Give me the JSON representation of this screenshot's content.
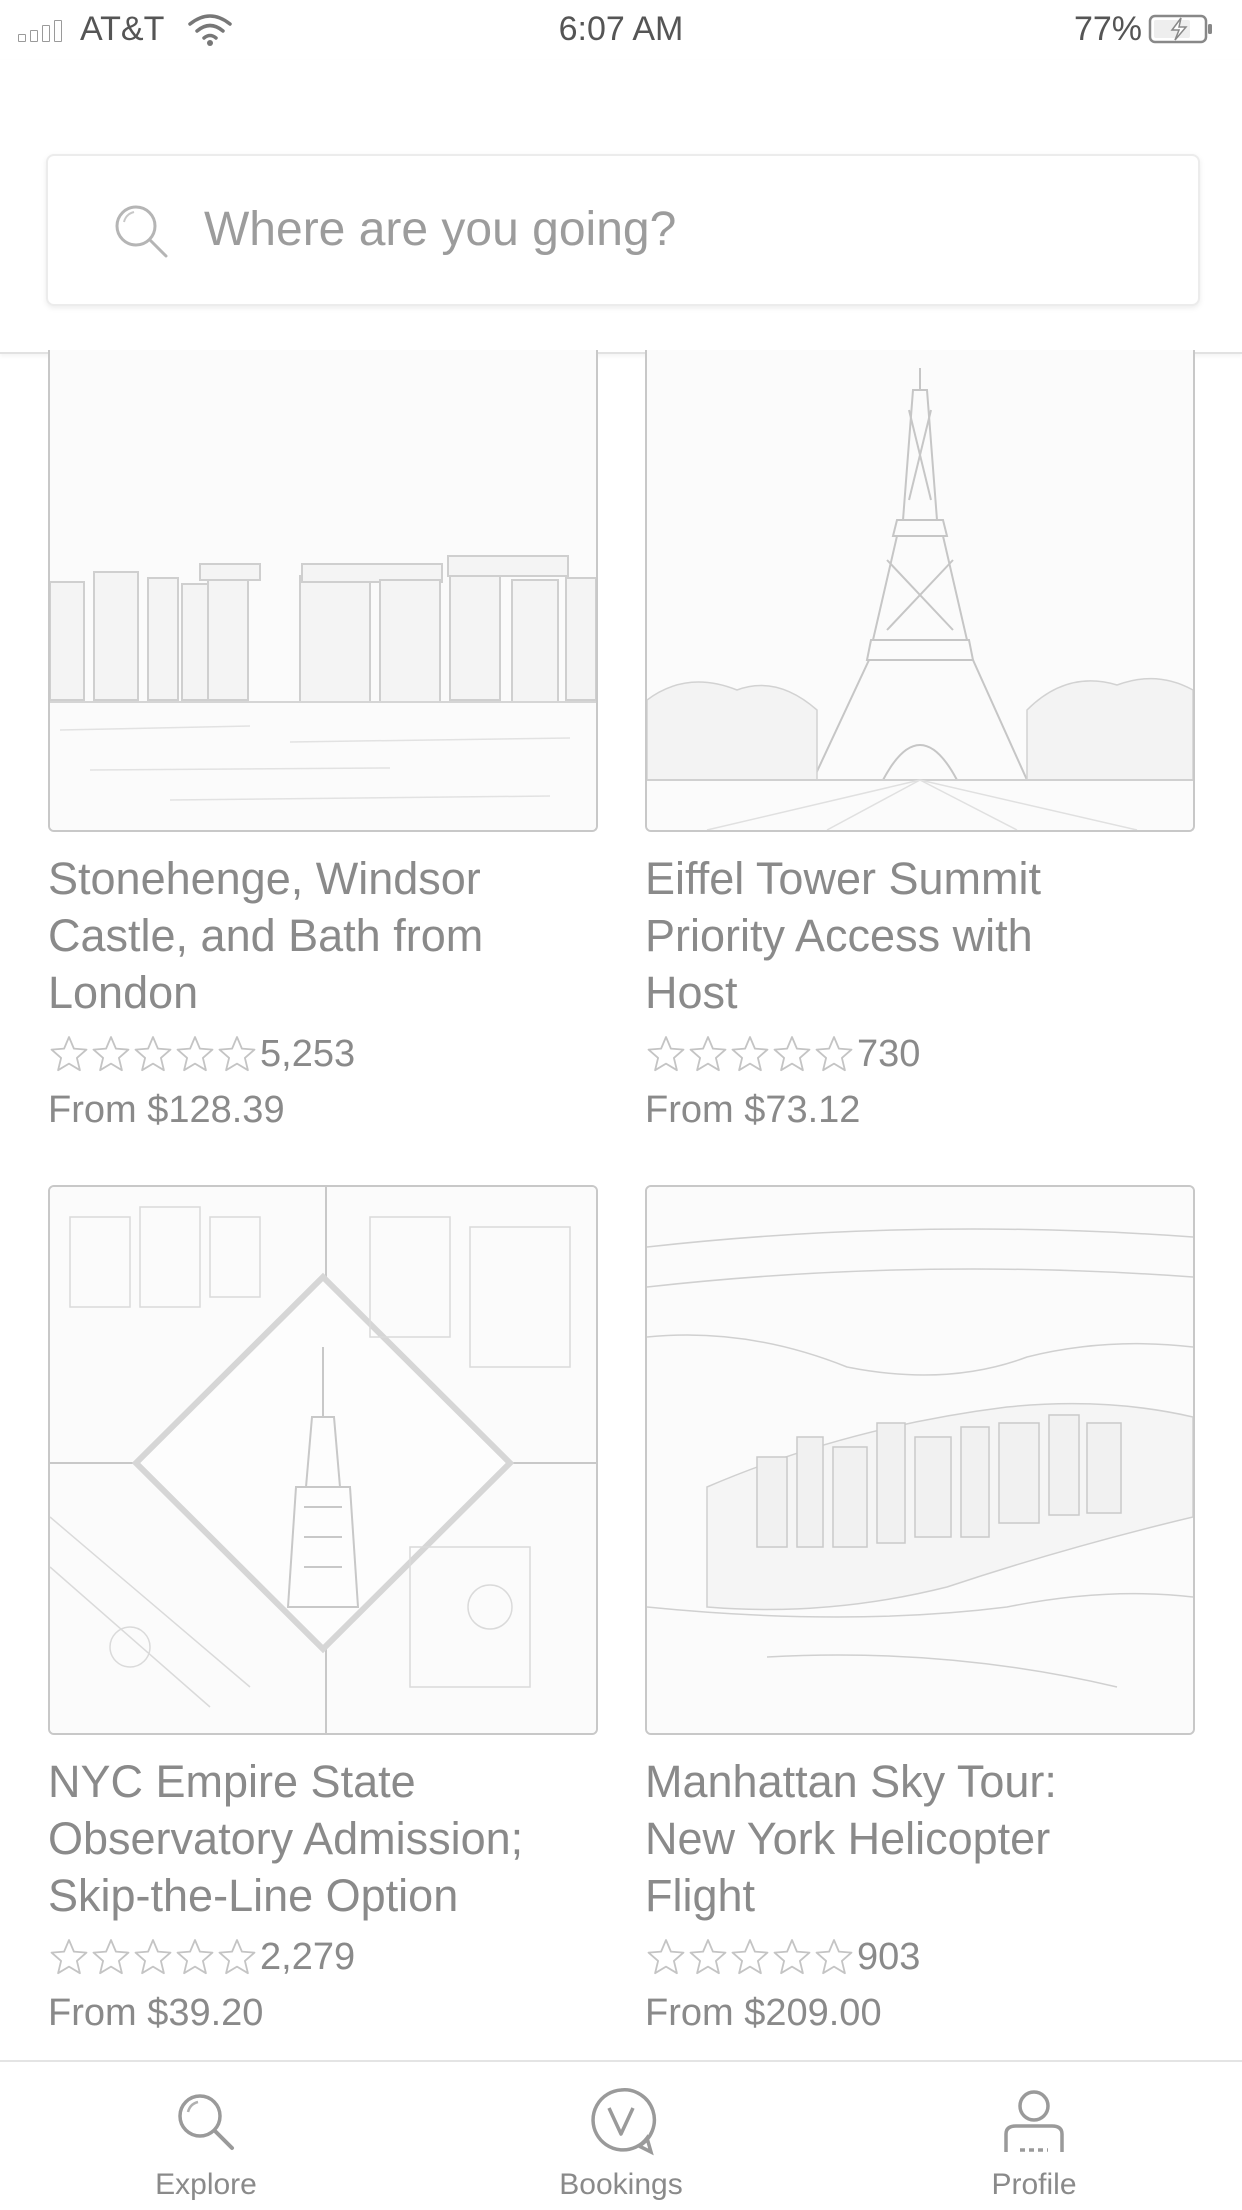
{
  "status_bar": {
    "carrier": "AT&T",
    "time": "6:07 AM",
    "battery": "77%"
  },
  "search": {
    "placeholder": "Where are you going?"
  },
  "cards": [
    {
      "title_lines": [
        "Stonehenge, Windsor",
        "Castle, and Bath from",
        "London"
      ],
      "review_count": "5,253",
      "price": "From $128.39"
    },
    {
      "title_lines": [
        "Eiffel Tower Summit",
        "Priority Access with",
        "Host"
      ],
      "review_count": "730",
      "price": "From $73.12"
    },
    {
      "title_lines": [
        "NYC Empire State",
        "Observatory Admission;",
        "Skip-the-Line Option"
      ],
      "review_count": "2,279",
      "price": "From $39.20"
    },
    {
      "title_lines": [
        "Manhattan Sky Tour:",
        "New York Helicopter",
        "Flight"
      ],
      "review_count": "903",
      "price": "From $209.00"
    }
  ],
  "tabs": [
    {
      "label": "Explore",
      "icon": "search-icon"
    },
    {
      "label": "Bookings",
      "icon": "bookings-v-icon"
    },
    {
      "label": "Profile",
      "icon": "profile-icon"
    }
  ]
}
